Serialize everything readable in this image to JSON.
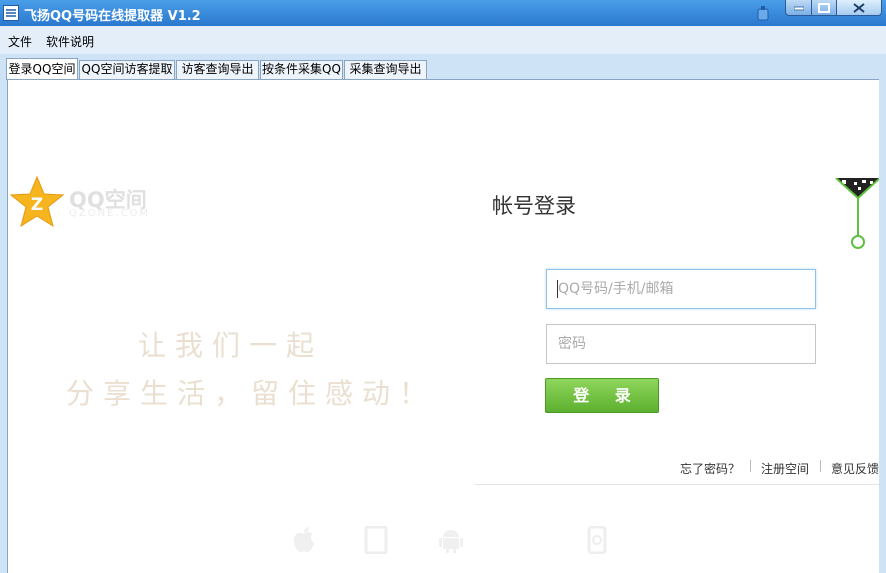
{
  "window": {
    "title": "飞扬QQ号码在线提取器 V1.2"
  },
  "menu": [
    "文件",
    "软件说明"
  ],
  "tabs": [
    "登录QQ空间",
    "QQ空间访客提取",
    "访客查询导出",
    "按条件采集QQ",
    "采集查询导出"
  ],
  "brand": {
    "name": "QQ空间",
    "domain": "QZONE.COM"
  },
  "slogan": [
    "让我们一起",
    "分享生活，留住感动！"
  ],
  "login": {
    "title": "帐号登录",
    "username_placeholder": "QQ号码/手机/邮箱",
    "password_placeholder": "密码",
    "submit_label": "登 录",
    "links": [
      "忘了密码？",
      "注册空间",
      "意见反馈"
    ]
  },
  "colors": {
    "title_bar": "#2a78cf",
    "login_button": "#5cb030",
    "brand_star": "#f6b51e",
    "qr_accent": "#5fbf3f"
  },
  "icons": [
    "app-icon",
    "pin-icon",
    "minimize-icon",
    "maximize-icon",
    "close-icon",
    "qzone-star-icon",
    "qr-code-icon",
    "apple-icon",
    "tablet-icon",
    "android-icon",
    "mobile-qq-icon"
  ]
}
